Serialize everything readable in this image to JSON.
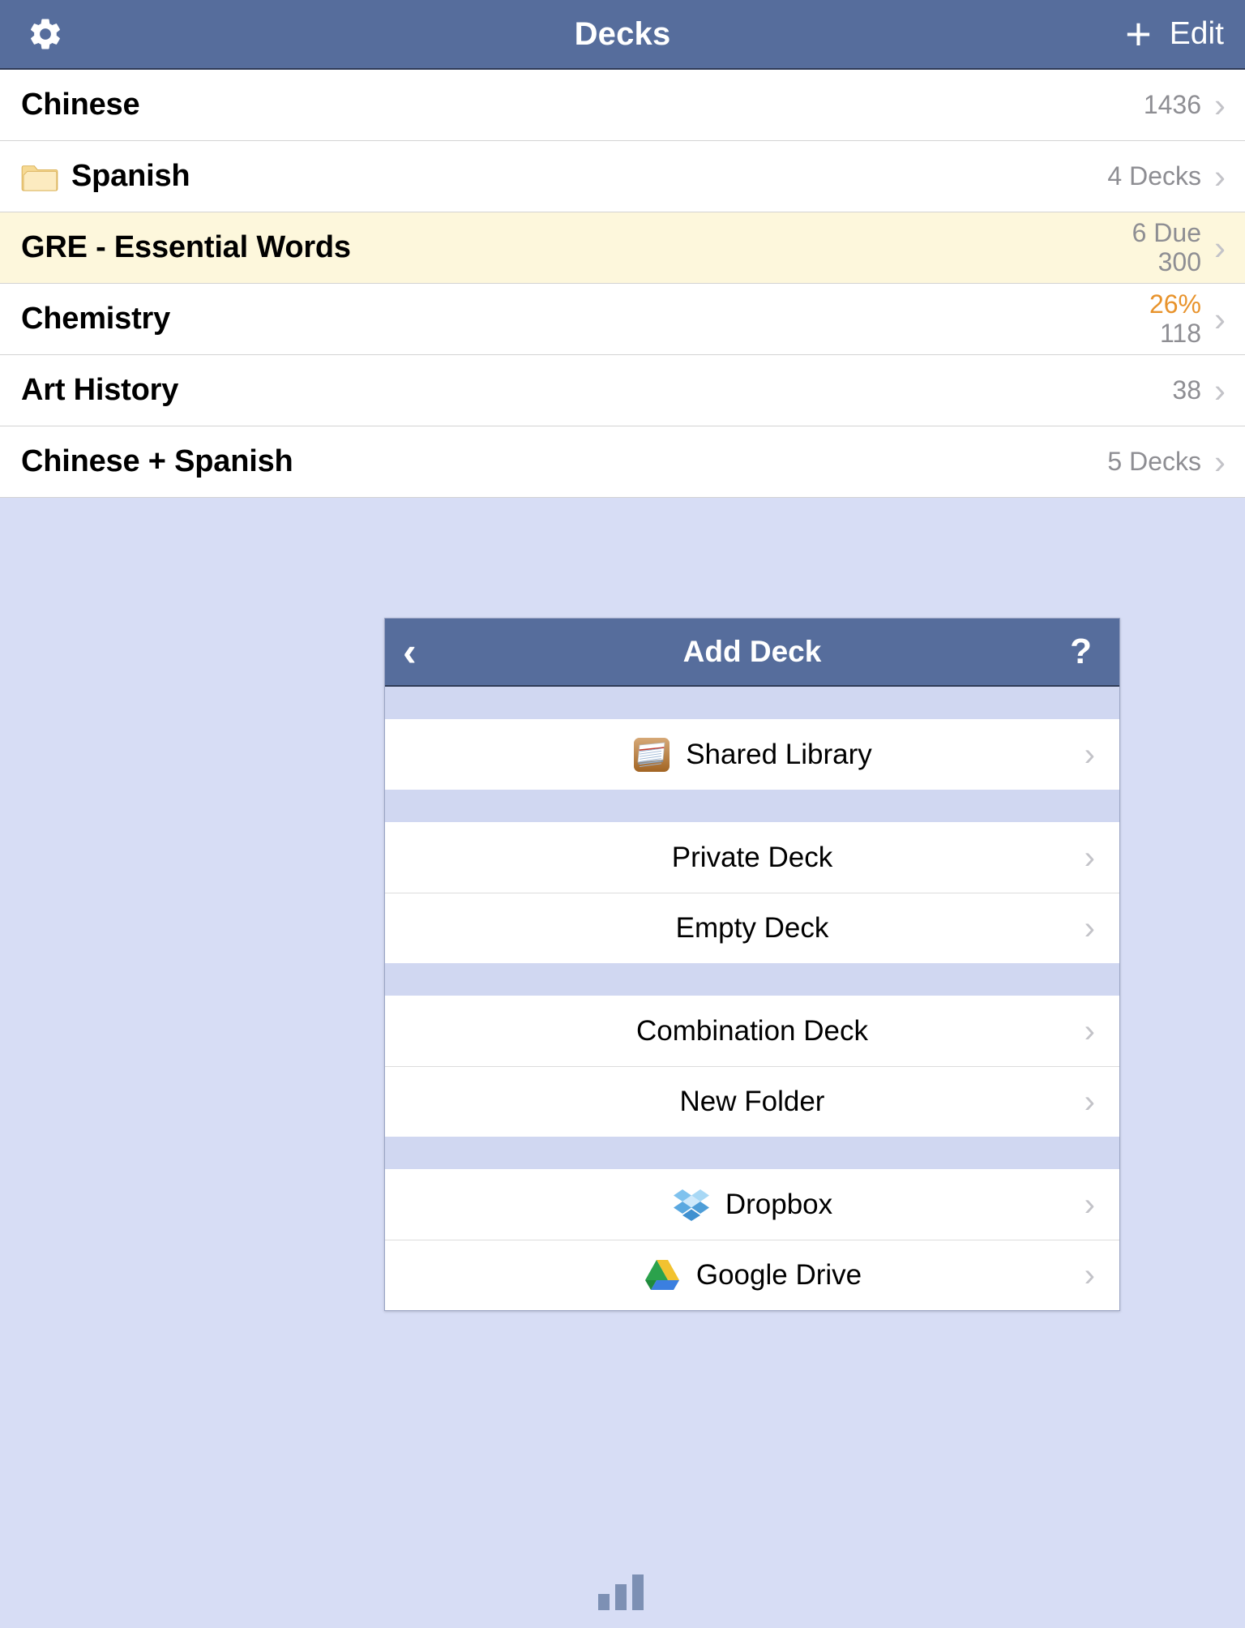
{
  "navbar": {
    "title": "Decks",
    "gear_icon": "gear-icon",
    "add_label": "+",
    "edit_label": "Edit"
  },
  "deck_list": {
    "rows": [
      {
        "name": "Chinese",
        "icon": null,
        "meta_top": "1436",
        "meta_bottom": "",
        "accent": false,
        "highlight": false
      },
      {
        "name": "Spanish",
        "icon": "folder-icon",
        "meta_top": "4 Decks",
        "meta_bottom": "",
        "accent": false,
        "highlight": false
      },
      {
        "name": "GRE - Essential Words",
        "icon": null,
        "meta_top": "6 Due",
        "meta_bottom": "300",
        "accent": false,
        "highlight": true
      },
      {
        "name": "Chemistry",
        "icon": null,
        "meta_top": "26%",
        "meta_bottom": "118",
        "accent": true,
        "highlight": false
      },
      {
        "name": "Art History",
        "icon": null,
        "meta_top": "38",
        "meta_bottom": "",
        "accent": false,
        "highlight": false
      },
      {
        "name": "Chinese + Spanish",
        "icon": null,
        "meta_top": "5 Decks",
        "meta_bottom": "",
        "accent": false,
        "highlight": false
      }
    ]
  },
  "add_deck_modal": {
    "title": "Add Deck",
    "back_icon": "chevron-left-icon",
    "help_icon": "question-mark-icon",
    "groups": [
      {
        "items": [
          {
            "label": "Shared Library",
            "icon": "index-cards-icon"
          }
        ]
      },
      {
        "items": [
          {
            "label": "Private Deck",
            "icon": null
          },
          {
            "label": "Empty Deck",
            "icon": null
          }
        ]
      },
      {
        "items": [
          {
            "label": "Combination Deck",
            "icon": null
          },
          {
            "label": "New Folder",
            "icon": null
          }
        ]
      },
      {
        "items": [
          {
            "label": "Dropbox",
            "icon": "dropbox-icon"
          },
          {
            "label": "Google Drive",
            "icon": "google-drive-icon"
          }
        ]
      }
    ]
  },
  "bottom_bar": {
    "icon": "bar-chart-icon"
  },
  "colors": {
    "navbar": "#566d9c",
    "navbar_border": "#2f3b57",
    "background": "#d7ddf5",
    "row_bg": "#ffffff",
    "row_highlight": "#fdf7dc",
    "meta_text": "#8e8e93",
    "accent": "#e8932c",
    "chevron": "#c3c3c8",
    "group_gap": "#d0d7f1"
  }
}
